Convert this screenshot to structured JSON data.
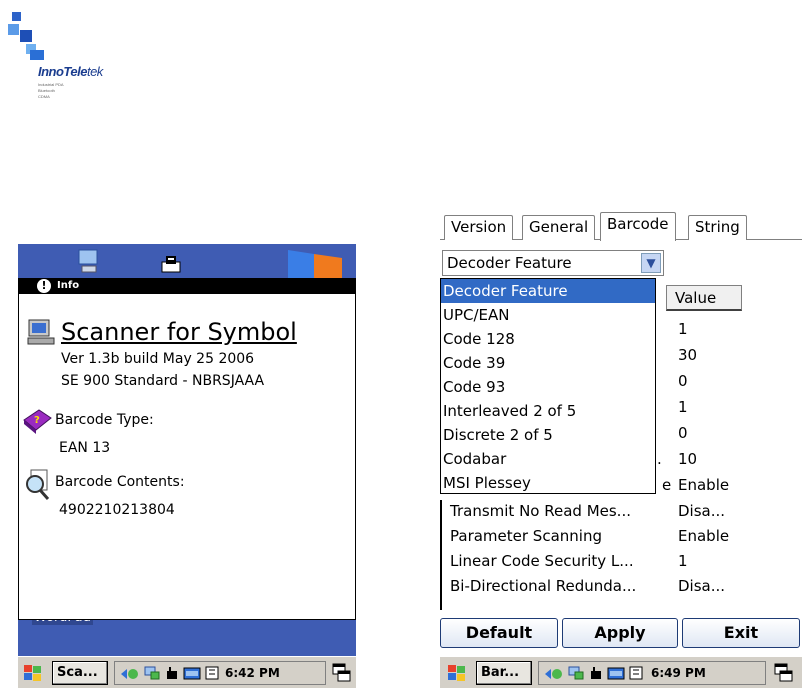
{
  "logo": {
    "brand_a": "InnoTele",
    "brand_b": "tek",
    "sub1": "Industrial PDA",
    "sub2": "Bluetooth",
    "sub3": "CDMA"
  },
  "left": {
    "info_title": "Info",
    "app_title": "Scanner for Symbol",
    "version": "Ver 1.3b build May 25 2006",
    "model": "SE 900 Standard - NBRSJAAA",
    "barcode_type_label": "Barcode Type:",
    "barcode_type_value": "EAN 13",
    "barcode_contents_label": "Barcode Contents:",
    "barcode_contents_value": "4902210213804",
    "desktop_label": "WordPad",
    "taskbar_task": "Sca...",
    "clock": "6:42 PM"
  },
  "right": {
    "tabs": [
      "Version",
      "General",
      "Barcode",
      "String"
    ],
    "active_tab": "Barcode",
    "combo_value": "Decoder Feature",
    "column_value": "Value",
    "dropdown": [
      "Decoder Feature",
      "UPC/EAN",
      "Code 128",
      "Code 39",
      "Code 93",
      "Interleaved 2 of 5",
      "Discrete 2 of 5",
      "Codabar",
      "MSI Plessey"
    ],
    "values_hidden_rows": [
      "1",
      "30",
      "0",
      "1",
      "0",
      "10",
      "Enable"
    ],
    "partial_name_codabar_row": ".",
    "partial_name_msi_row": "e",
    "rows": [
      {
        "name": "Transmit No Read Mes...",
        "value": "Disa..."
      },
      {
        "name": "Parameter Scanning",
        "value": "Enable"
      },
      {
        "name": "Linear Code Security L...",
        "value": "1"
      },
      {
        "name": "Bi-Directional Redunda...",
        "value": "Disa..."
      }
    ],
    "buttons": {
      "default": "Default",
      "apply": "Apply",
      "exit": "Exit"
    },
    "taskbar_task": "Bar...",
    "clock": "6:49 PM"
  },
  "colors": {
    "desktop": "#3f5cb3",
    "selection": "#316ac5",
    "brand": "#1b3d8f"
  }
}
